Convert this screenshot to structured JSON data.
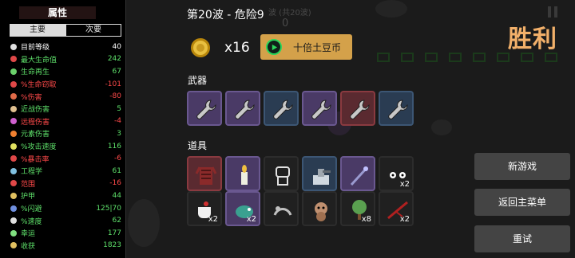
{
  "stats_panel": {
    "title": "属性",
    "tabs": [
      {
        "label": "主要",
        "active": true
      },
      {
        "label": "次要",
        "active": false
      }
    ],
    "rows": [
      {
        "icon": "level-icon",
        "label": "目前等级",
        "value": "40",
        "color": "#ffffff",
        "icon_color": "#e0e0e0"
      },
      {
        "icon": "heart-icon",
        "label": "最大生命值",
        "value": "242",
        "color": "#5ee06a",
        "icon_color": "#e04848"
      },
      {
        "icon": "regen-icon",
        "label": "生命再生",
        "value": "67",
        "color": "#5ee06a",
        "icon_color": "#6ad06a"
      },
      {
        "icon": "lifesteal-icon",
        "label": "%生命窃取",
        "value": "-101",
        "color": "#ff4a4a",
        "icon_color": "#e04848"
      },
      {
        "icon": "damage-icon",
        "label": "%伤害",
        "value": "-80",
        "color": "#ff4a4a",
        "icon_color": "#e06a48"
      },
      {
        "icon": "melee-icon",
        "label": "近战伤害",
        "value": "5",
        "color": "#5ee06a",
        "icon_color": "#e0c090"
      },
      {
        "icon": "ranged-icon",
        "label": "远程伤害",
        "value": "-4",
        "color": "#ff4a4a",
        "icon_color": "#d060d0"
      },
      {
        "icon": "elemental-icon",
        "label": "元素伤害",
        "value": "3",
        "color": "#5ee06a",
        "icon_color": "#f08030"
      },
      {
        "icon": "attack-speed-icon",
        "label": "%攻击速度",
        "value": "116",
        "color": "#5ee06a",
        "icon_color": "#e0e060"
      },
      {
        "icon": "crit-icon",
        "label": "%暴击率",
        "value": "-6",
        "color": "#ff4a4a",
        "icon_color": "#e04848"
      },
      {
        "icon": "engineering-icon",
        "label": "工程学",
        "value": "61",
        "color": "#5ee06a",
        "icon_color": "#80c0e0"
      },
      {
        "icon": "range-icon",
        "label": "范围",
        "value": "-16",
        "color": "#ff4a4a",
        "icon_color": "#e04848"
      },
      {
        "icon": "armor-icon",
        "label": "护甲",
        "value": "44",
        "color": "#5ee06a",
        "icon_color": "#e0c060"
      },
      {
        "icon": "dodge-icon",
        "label": "%闪避",
        "value": "125|70",
        "color": "#5ee06a",
        "icon_color": "#7090e0"
      },
      {
        "icon": "speed-icon",
        "label": "%速度",
        "value": "62",
        "color": "#5ee06a",
        "icon_color": "#e0e0e0"
      },
      {
        "icon": "luck-icon",
        "label": "幸运",
        "value": "177",
        "color": "#5ee06a",
        "icon_color": "#80e080"
      },
      {
        "icon": "harvest-icon",
        "label": "收获",
        "value": "1823",
        "color": "#5ee06a",
        "icon_color": "#e0c060"
      }
    ]
  },
  "header": {
    "wave_title": "第20波 - 危险9",
    "ghost_wave": "波 (共20波)",
    "ghost_number": "0",
    "victory": "胜利"
  },
  "currency": {
    "coin_icon": "coin-icon",
    "coin_count": "x16",
    "reroll_label": "十倍土豆币"
  },
  "weapons": {
    "label": "武器",
    "slots": [
      {
        "icon": "wrench-icon",
        "tier": "purple"
      },
      {
        "icon": "wrench-icon",
        "tier": "purple"
      },
      {
        "icon": "wrench-icon",
        "tier": "blue"
      },
      {
        "icon": "wrench-icon",
        "tier": "purple"
      },
      {
        "icon": "wrench-icon",
        "tier": "red"
      },
      {
        "icon": "wrench-icon",
        "tier": "blue"
      }
    ]
  },
  "items": {
    "label": "道具",
    "slots": [
      {
        "icon": "jacket-icon",
        "tier": "red",
        "qty": ""
      },
      {
        "icon": "candle-icon",
        "tier": "purple",
        "qty": ""
      },
      {
        "icon": "robot-icon",
        "tier": "plain",
        "qty": ""
      },
      {
        "icon": "turret-icon",
        "tier": "blue",
        "qty": ""
      },
      {
        "icon": "staff-icon",
        "tier": "purple",
        "qty": ""
      },
      {
        "icon": "eyes-icon",
        "tier": "plain",
        "qty": "x2"
      },
      {
        "icon": "teacup-icon",
        "tier": "plain",
        "qty": "x2"
      },
      {
        "icon": "chameleon-icon",
        "tier": "purple",
        "qty": "x2"
      },
      {
        "icon": "fossil-icon",
        "tier": "plain",
        "qty": ""
      },
      {
        "icon": "monkey-icon",
        "tier": "plain",
        "qty": ""
      },
      {
        "icon": "tree-icon",
        "tier": "plain",
        "qty": "x8"
      },
      {
        "icon": "twig-icon",
        "tier": "plain",
        "qty": "x2"
      }
    ]
  },
  "menu": {
    "new_game": "新游戏",
    "main_menu": "返回主菜单",
    "retry": "重试"
  },
  "colors": {
    "victory": "#f2b06a",
    "reroll_button": "#d4a14a",
    "positive_stat": "#5ee06a",
    "negative_stat": "#ff4a4a"
  }
}
